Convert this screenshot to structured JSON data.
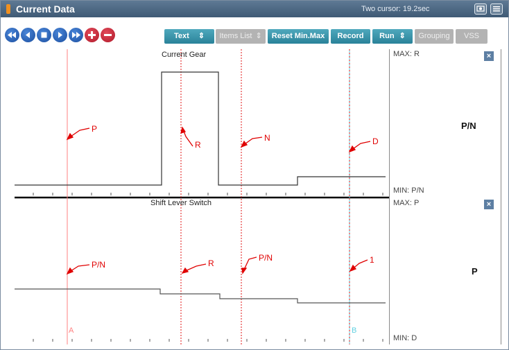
{
  "title": "Current Data",
  "cursor_info": "Two cursor: 19.2sec",
  "toolbar": {
    "text_label": "Text",
    "items_list_label": "Items List",
    "reset_label": "Reset Min.Max",
    "record_label": "Record",
    "run_label": "Run",
    "grouping_label": "Grouping",
    "vss_label": "VSS",
    "spin_glyph": "⇕"
  },
  "panel1": {
    "title": "Current Gear",
    "max_label": "MAX: R",
    "min_label": "MIN: P/N",
    "current_value": "P/N",
    "annotations": [
      "P",
      "R",
      "N",
      "D"
    ]
  },
  "panel2": {
    "title": "Shift Lever Switch",
    "max_label": "MAX: P",
    "min_label": "MIN: D",
    "current_value": "P",
    "annotations": [
      "P/N",
      "R",
      "P/N",
      "1"
    ]
  },
  "cursor_a_label": "A",
  "cursor_b_label": "B",
  "close_glyph": "×",
  "colors": {
    "cursor_a": "#ff8080",
    "cursor_dotted": "#e01010",
    "cursor_b": "#60d0e0",
    "trace": "#333333",
    "annotation": "#e00000"
  }
}
